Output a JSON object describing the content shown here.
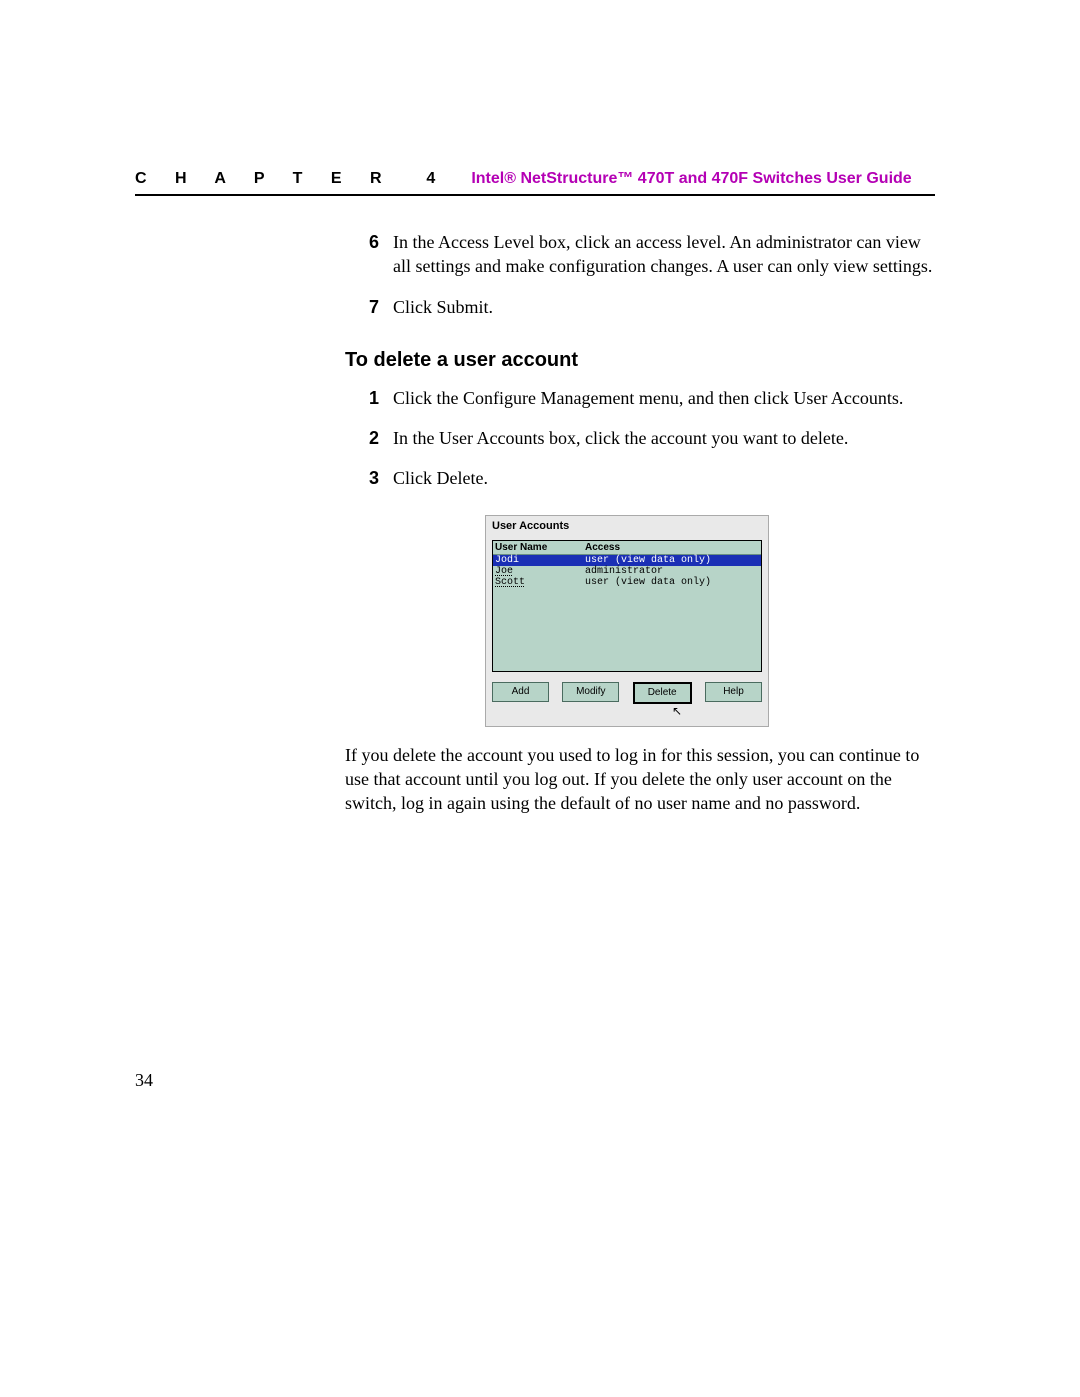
{
  "header": {
    "chapter_label": "C H A P T E R  4",
    "guide_title": "Intel® NetStructure™ 470T and 470F Switches User Guide"
  },
  "continued_steps": [
    {
      "num": "6",
      "text": "In the Access Level box, click an access level. An administrator can view all settings and make configuration changes. A user can only view settings."
    },
    {
      "num": "7",
      "text": "Click Submit."
    }
  ],
  "section_heading": "To delete a user account",
  "delete_steps": [
    {
      "num": "1",
      "text": "Click the Configure Management menu, and then click User Accounts."
    },
    {
      "num": "2",
      "text": "In the User Accounts box, click the account you want to delete."
    },
    {
      "num": "3",
      "text": "Click Delete."
    }
  ],
  "user_accounts_widget": {
    "title": "User Accounts",
    "columns": {
      "c1": "User Name",
      "c2": "Access"
    },
    "rows": [
      {
        "name": "Jodi",
        "access": "user (view data only)",
        "selected": true
      },
      {
        "name": "Joe",
        "access": "administrator",
        "selected": false
      },
      {
        "name": "Scott",
        "access": "user (view data only)",
        "selected": false
      }
    ],
    "buttons": {
      "add": "Add",
      "modify": "Modify",
      "delete": "Delete",
      "help": "Help"
    }
  },
  "closing_paragraph": "If you delete the account you used to log in for this session, you can continue to use that account until you log out. If you delete the only user account on the switch, log in again using the default of no user name and no password.",
  "page_number": "34"
}
